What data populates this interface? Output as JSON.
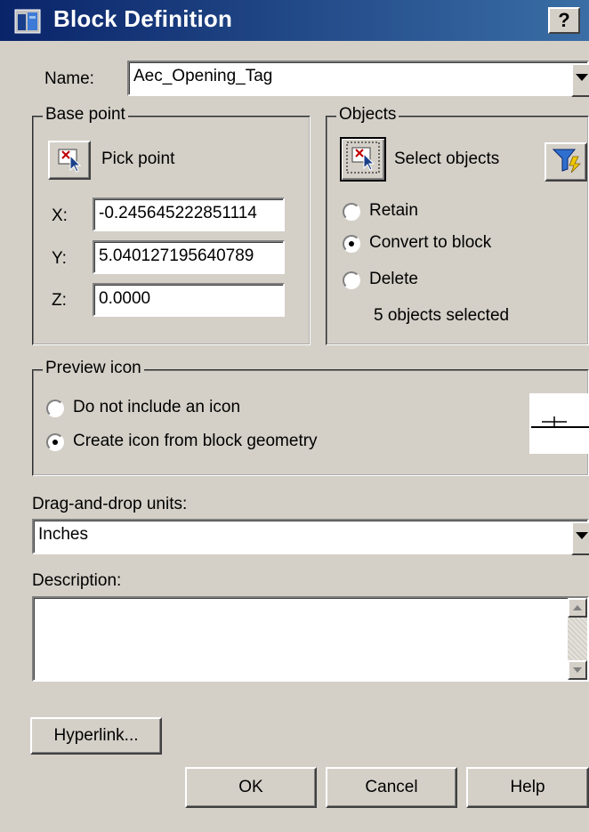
{
  "window": {
    "title": "Block Definition",
    "help_label": "?"
  },
  "name": {
    "label": "Name:",
    "value": "Aec_Opening_Tag"
  },
  "base_point": {
    "legend": "Base point",
    "pick_label": "Pick point",
    "x_label": "X:",
    "x_value": "-0.245645222851114",
    "y_label": "Y:",
    "y_value": "5.040127195640789",
    "z_label": "Z:",
    "z_value": "0.0000"
  },
  "objects": {
    "legend": "Objects",
    "select_label": "Select objects",
    "options": [
      {
        "label": "Retain",
        "selected": false
      },
      {
        "label": "Convert to block",
        "selected": true
      },
      {
        "label": "Delete",
        "selected": false
      }
    ],
    "status": "5 objects selected"
  },
  "preview": {
    "legend": "Preview icon",
    "options": [
      {
        "label": "Do not include an icon",
        "selected": false
      },
      {
        "label": "Create icon from block geometry",
        "selected": true
      }
    ]
  },
  "units": {
    "label": "Drag-and-drop units:",
    "value": "Inches"
  },
  "description": {
    "label": "Description:",
    "value": ""
  },
  "buttons": {
    "hyperlink": "Hyperlink...",
    "ok": "OK",
    "cancel": "Cancel",
    "help": "Help"
  },
  "colors": {
    "title_start": "#0a246a",
    "title_end": "#3a6ea5",
    "face": "#d4d0c8"
  },
  "icons": {
    "app": "block-def-icon",
    "pick": "pick-point-icon",
    "select": "select-objects-icon",
    "filter": "quick-select-filter-icon"
  }
}
